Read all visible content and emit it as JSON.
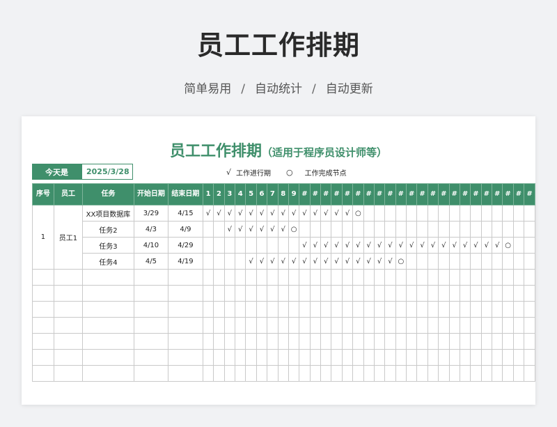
{
  "header": {
    "title": "员工工作排期",
    "tags": [
      "简单易用",
      "自动统计",
      "自动更新"
    ],
    "separator": "/"
  },
  "sheet": {
    "title": "员工工作排期",
    "title_note": "（适用于程序员设计师等）",
    "today_label": "今天是",
    "today_value": "2025/3/28",
    "legend": [
      {
        "mark": "√",
        "label": "工作进行期"
      },
      {
        "mark": "○",
        "label": "工作完成节点"
      }
    ],
    "columns": {
      "index": "序号",
      "employee": "员工",
      "task": "任务",
      "start": "开始日期",
      "end": "结束日期"
    },
    "day_headers": [
      "1",
      "2",
      "3",
      "4",
      "5",
      "6",
      "7",
      "8",
      "9",
      "#",
      "#",
      "#",
      "#",
      "#",
      "#",
      "#",
      "#",
      "#",
      "#",
      "#",
      "#",
      "#",
      "#",
      "#",
      "#",
      "#",
      "#",
      "#",
      "#",
      "#",
      "#"
    ],
    "rows": [
      {
        "index": "1",
        "employee": "员工1",
        "task": "XX项目数据库",
        "start": "3/29",
        "end": "4/15",
        "first_day": 1,
        "last_day": 14
      },
      {
        "index": "",
        "employee": "",
        "task": "任务2",
        "start": "4/3",
        "end": "4/9",
        "first_day": 3,
        "last_day": 8
      },
      {
        "index": "",
        "employee": "",
        "task": "任务3",
        "start": "4/10",
        "end": "4/29",
        "first_day": 10,
        "last_day": 28
      },
      {
        "index": "",
        "employee": "",
        "task": "任务4",
        "start": "4/5",
        "end": "4/19",
        "first_day": 5,
        "last_day": 18
      }
    ],
    "empty_rows": 7,
    "accent_color": "#3f8f6b"
  }
}
